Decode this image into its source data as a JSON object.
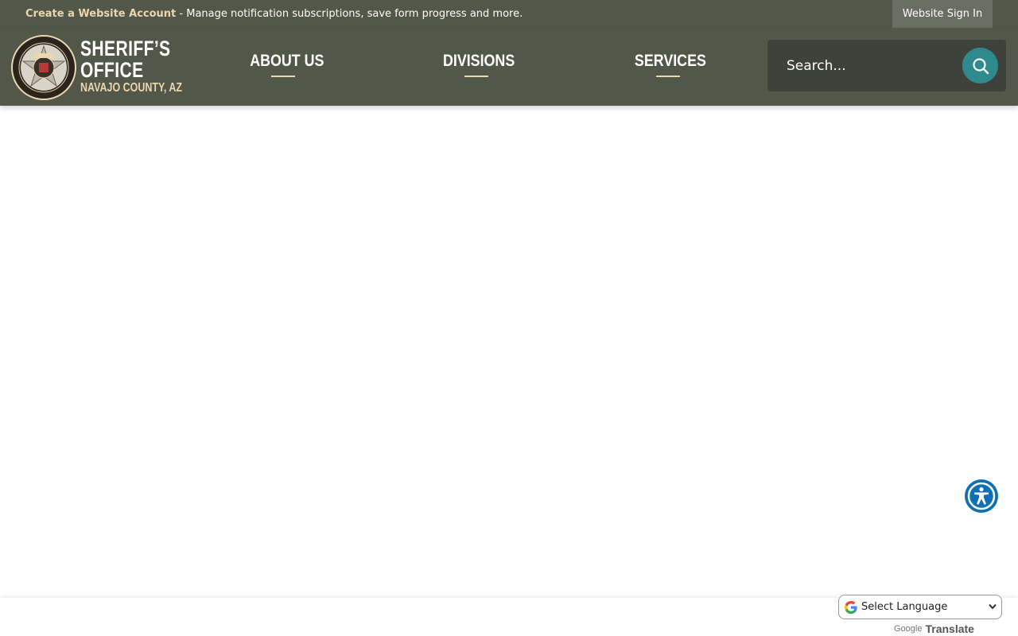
{
  "topbar": {
    "create_account_link": "Create a Website Account",
    "create_account_message": " - Manage notification subscriptions, save form progress and more.",
    "sign_in_label": "Website Sign In"
  },
  "logo": {
    "line1": "SHERIFF’S",
    "line2": "OFFICE",
    "line3": "NAVAJO COUNTY, AZ"
  },
  "nav": {
    "items": [
      {
        "label": "ABOUT US"
      },
      {
        "label": "DIVISIONS"
      },
      {
        "label": "SERVICES"
      }
    ]
  },
  "search": {
    "placeholder": "Search..."
  },
  "translate": {
    "select_label": "Select Language",
    "powered_google": "Google",
    "powered_translate": "Translate"
  },
  "colors": {
    "header_bg": "#525749",
    "accent_gold": "#ead7b0",
    "search_button": "#2f8a8e",
    "accessibility_button": "#0f6fb5"
  },
  "icons": {
    "search": "search-icon",
    "accessibility": "accessibility-icon",
    "google": "google-g-icon",
    "chevron": "chevron-down-icon"
  }
}
